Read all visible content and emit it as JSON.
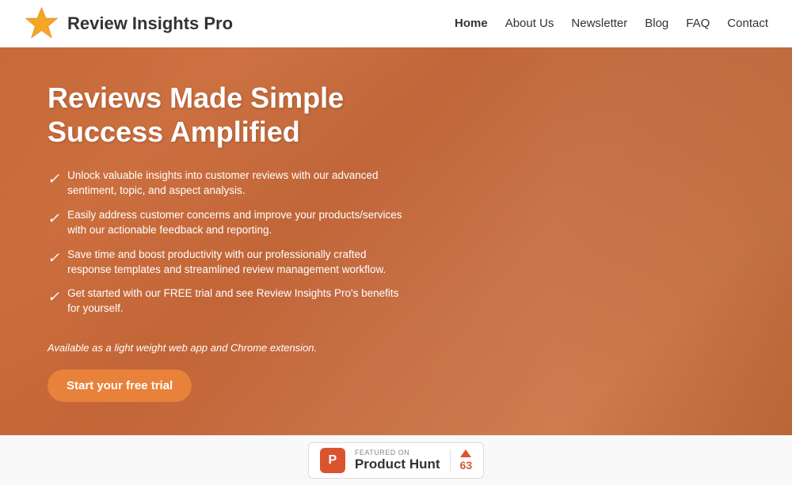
{
  "header": {
    "logo_text": "Review Insights Pro",
    "nav": [
      {
        "label": "Home",
        "active": true
      },
      {
        "label": "About Us",
        "active": false
      },
      {
        "label": "Newsletter",
        "active": false
      },
      {
        "label": "Blog",
        "active": false
      },
      {
        "label": "FAQ",
        "active": false
      },
      {
        "label": "Contact",
        "active": false
      }
    ]
  },
  "hero": {
    "title_line1": "Reviews Made Simple",
    "title_line2": "Success Amplified",
    "features": [
      "Unlock valuable insights into customer reviews with our advanced sentiment, topic, and aspect analysis.",
      "Easily address customer concerns and improve your products/services with our actionable feedback and reporting.",
      "Save time and boost productivity with our professionally crafted response templates and streamlined review management workflow.",
      "Get started with our FREE trial and see Review Insights Pro's benefits for yourself."
    ],
    "available_text": "Available as a light weight web app and Chrome extension.",
    "cta_label": "Start your free trial"
  },
  "footer": {
    "ph_featured_label": "FEATURED ON",
    "ph_name": "Product Hunt",
    "ph_votes": "63"
  }
}
